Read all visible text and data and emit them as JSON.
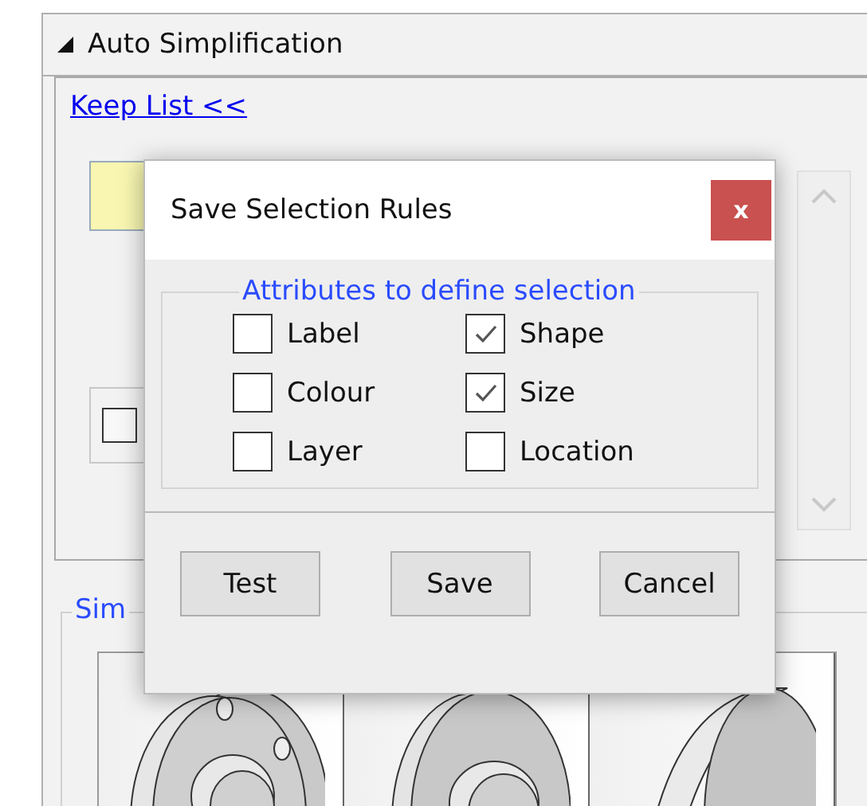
{
  "panel": {
    "title": "Auto Simplification",
    "expanded": true,
    "link": "Keep List <<",
    "group_legend": "Sim",
    "row_checked": false
  },
  "dialog": {
    "title": "Save Selection Rules",
    "close": "x",
    "legend": "Attributes to define selection",
    "attributes": [
      {
        "label": "Label",
        "checked": false
      },
      {
        "label": "Shape",
        "checked": true
      },
      {
        "label": "Colour",
        "checked": false
      },
      {
        "label": "Size",
        "checked": true
      },
      {
        "label": "Layer",
        "checked": false
      },
      {
        "label": "Location",
        "checked": false
      }
    ],
    "buttons": [
      "Test",
      "Save",
      "Cancel"
    ]
  }
}
